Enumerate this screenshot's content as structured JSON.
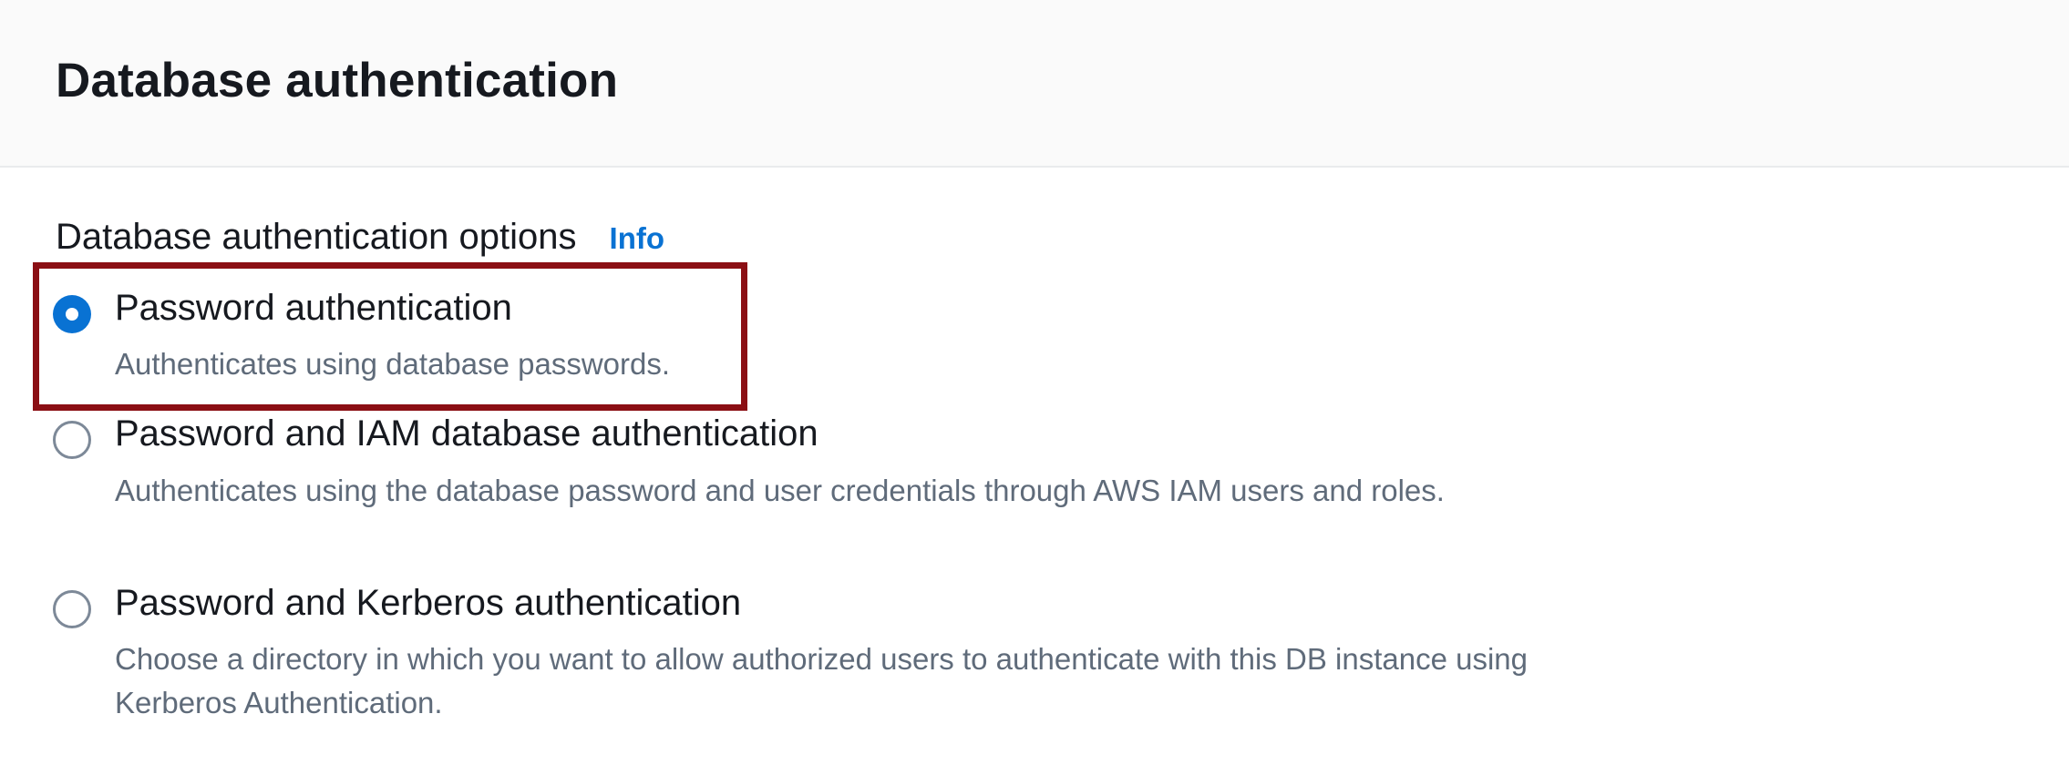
{
  "section": {
    "title": "Database authentication"
  },
  "field": {
    "label": "Database authentication options",
    "info_link": "Info"
  },
  "options": [
    {
      "title": "Password authentication",
      "description": "Authenticates using database passwords.",
      "selected": true
    },
    {
      "title": "Password and IAM database authentication",
      "description": "Authenticates using the database password and user credentials through AWS IAM users and roles.",
      "selected": false
    },
    {
      "title": "Password and Kerberos authentication",
      "description": "Choose a directory in which you want to allow authorized users to authenticate with this DB instance using Kerberos Authentication.",
      "selected": false
    }
  ],
  "colors": {
    "header_background": "#fafafa",
    "accent": "#0972d3",
    "highlight_border": "#8b0f14",
    "description_text": "#5f6b7a"
  }
}
